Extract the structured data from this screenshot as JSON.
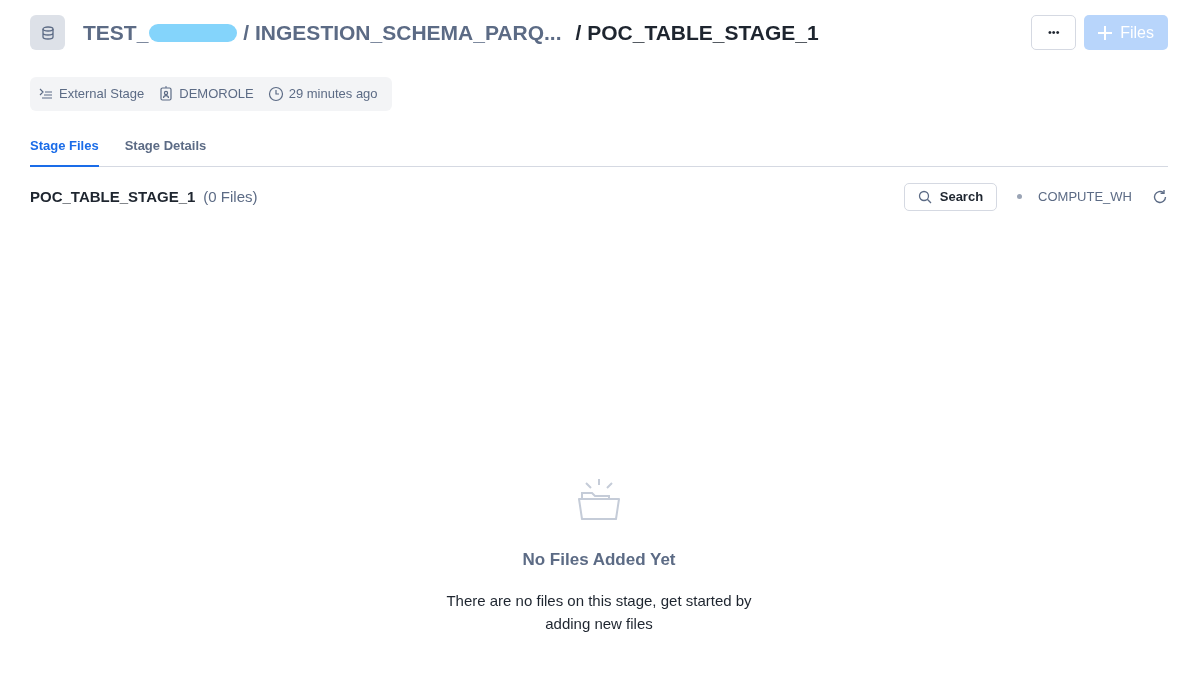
{
  "breadcrumb": [
    {
      "text": "TEST_",
      "redacted": true
    },
    {
      "text": "/ INGESTION_SCHEMA_PARQ...",
      "redacted": false
    },
    {
      "text": "/ POC_TABLE_STAGE_1",
      "redacted": false
    }
  ],
  "header_buttons": {
    "more": "•••",
    "add": {
      "label": "Files",
      "disabled": true
    }
  },
  "meta": [
    {
      "kind": "stage",
      "text": "External Stage"
    },
    {
      "kind": "role",
      "text": "DEMOROLE"
    },
    {
      "kind": "time",
      "text": "29 minutes ago"
    }
  ],
  "tabs": [
    {
      "label": "Stage Files",
      "selected": true
    },
    {
      "label": "Stage Details",
      "selected": false
    }
  ],
  "toolbar": {
    "title": "POC_TABLE_STAGE_1",
    "count": "(0 Files)",
    "search": "Search",
    "warehouse": "COMPUTE_WH"
  },
  "empty_state": {
    "title": "No Files Added Yet",
    "message": "There are no files on this stage, get started by adding new files"
  }
}
